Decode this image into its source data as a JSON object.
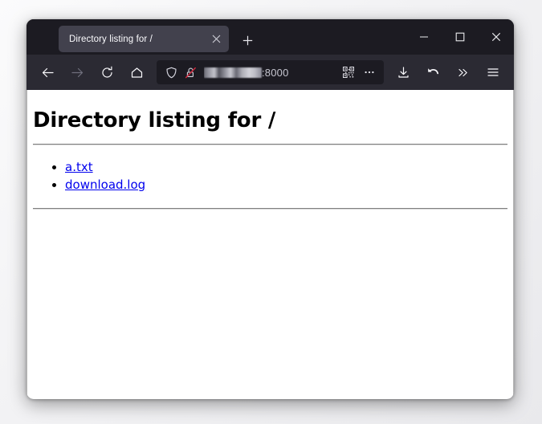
{
  "window": {
    "controls": {
      "minimize_label": "—",
      "maximize_label": "□",
      "close_label": "×"
    }
  },
  "tabstrip": {
    "tabs": [
      {
        "title": "Directory listing for /",
        "close_label": "×",
        "active": true
      }
    ],
    "new_tab_label": "+"
  },
  "toolbar": {
    "back_label": "←",
    "forward_label": "→",
    "reload_label": "↻",
    "home_label": "⌂",
    "downloads_label": "Downloads",
    "sync_label": "Sync",
    "overflow_label": "»",
    "menu_label": "≡"
  },
  "urlbar": {
    "shield_name": "tracking-protection-shield",
    "lock_name": "insecure-connection-lock",
    "host_redacted": true,
    "port_text": ":8000",
    "qr_label": "QR code",
    "page_actions_label": "•••"
  },
  "page": {
    "title": "Directory listing for /",
    "entries": [
      {
        "name": "a.txt"
      },
      {
        "name": "download.log"
      }
    ]
  },
  "colors": {
    "titlebar": "#1c1b22",
    "toolbar": "#2b2a33",
    "tab_active": "#42414d",
    "link": "#0000ee",
    "lock_strike": "#d5293e",
    "page_bg": "#ffffff"
  }
}
